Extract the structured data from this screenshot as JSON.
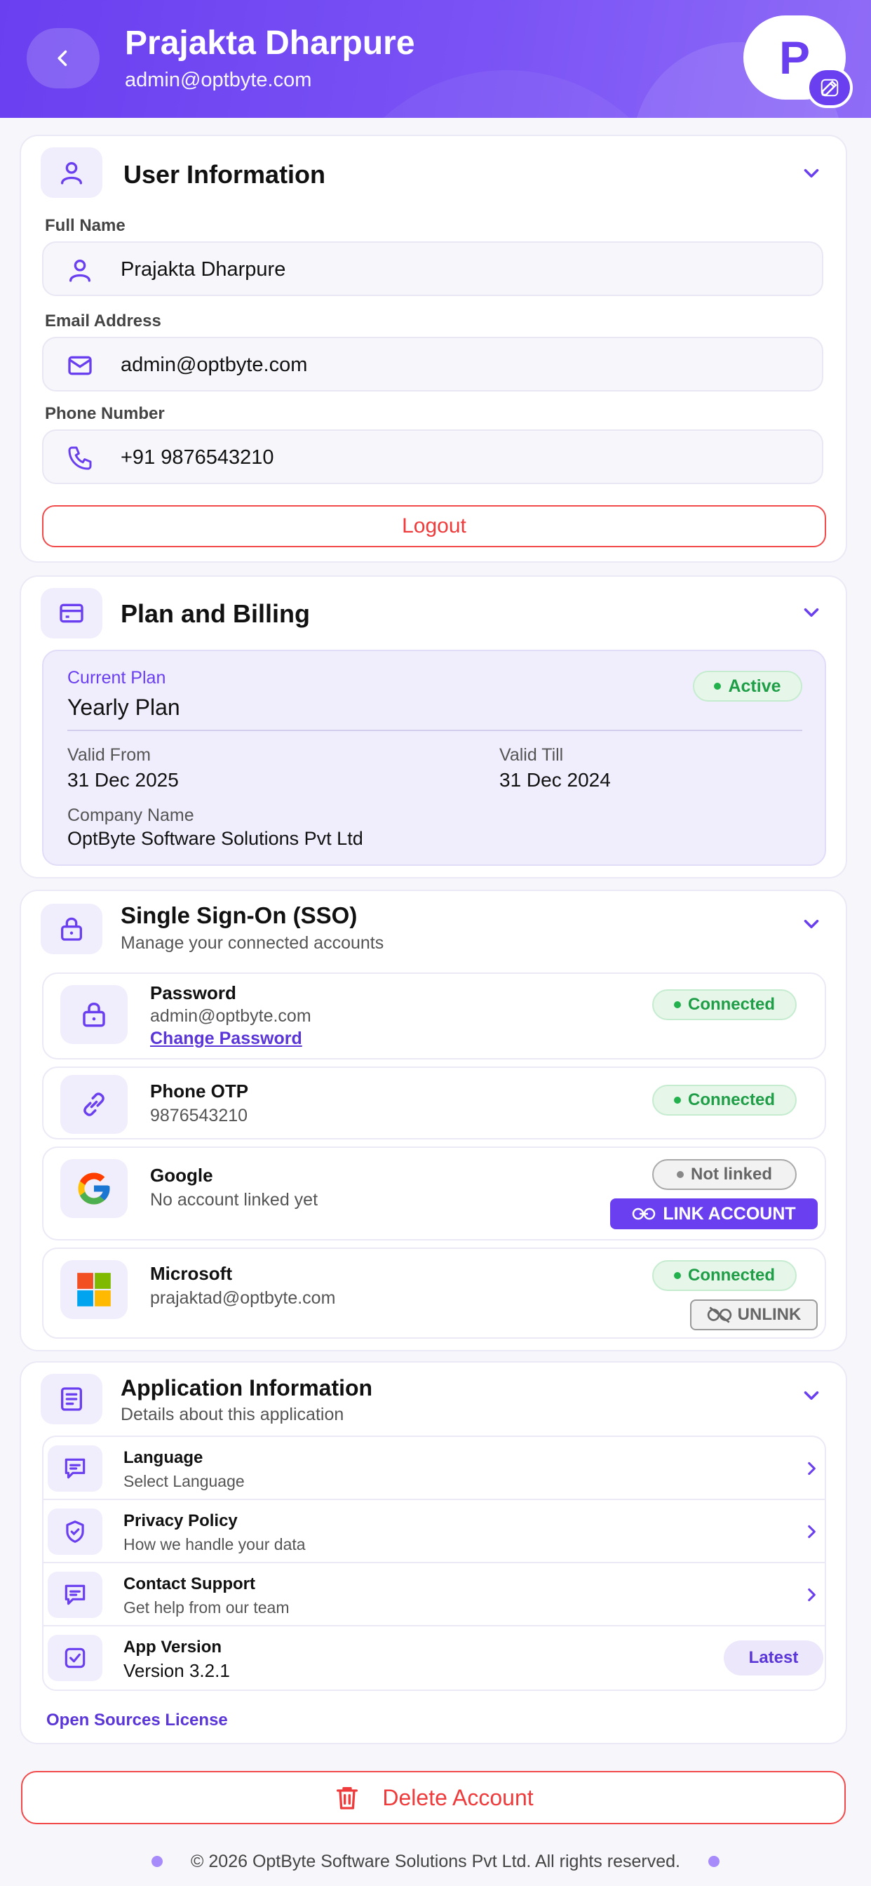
{
  "header": {
    "name": "Prajakta Dharpure",
    "email": "admin@optbyte.com",
    "avatar_initial": "P",
    "accent": "#6a3ff0"
  },
  "user_info": {
    "title": "User Information",
    "fields": [
      {
        "label": "Full Name",
        "value": "Prajakta Dharpure",
        "icon": "user-icon"
      },
      {
        "label": "Email Address",
        "value": "admin@optbyte.com",
        "icon": "mail-icon"
      },
      {
        "label": "Phone Number",
        "value": "+91 9876543210",
        "icon": "phone-icon"
      }
    ],
    "logout_label": "Logout"
  },
  "plan": {
    "title": "Plan and Billing",
    "current_plan_label": "Current Plan",
    "plan_name": "Yearly Plan",
    "status": "Active",
    "valid_from_label": "Valid From",
    "valid_from": "31 Dec 2025",
    "valid_till_label": "Valid Till",
    "valid_till": "31 Dec 2024",
    "company_label": "Company Name",
    "company": "OptByte Software Solutions Pvt Ltd"
  },
  "sso": {
    "title": "Single Sign-On (SSO)",
    "subtitle": "Manage your connected accounts",
    "items": [
      {
        "name": "Password",
        "detail": "admin@optbyte.com",
        "action": "Change Password",
        "status": "Connected",
        "icon": "lock-icon"
      },
      {
        "name": "Phone OTP",
        "detail": "9876543210",
        "status": "Connected",
        "icon": "link-icon"
      },
      {
        "name": "Google",
        "detail": "No account linked yet",
        "status": "Not linked",
        "action": "LINK ACCOUNT",
        "icon": "google-icon"
      },
      {
        "name": "Microsoft",
        "detail": "prajaktad@optbyte.com",
        "status": "Connected",
        "action": "UNLINK",
        "icon": "microsoft-icon"
      }
    ]
  },
  "app_info": {
    "title": "Application Information",
    "subtitle": "Details about this application",
    "rows": [
      {
        "title": "Language",
        "subtitle": "Select Language",
        "icon": "chat-icon"
      },
      {
        "title": "Privacy Policy",
        "subtitle": "How we handle your data",
        "icon": "shield-icon"
      },
      {
        "title": "Contact Support",
        "subtitle": "Get help from our team",
        "icon": "support-icon"
      },
      {
        "title": "App Version",
        "subtitle": "Version 3.2.1",
        "badge": "Latest",
        "icon": "check-icon"
      }
    ],
    "oss_link": "Open Sources License"
  },
  "delete_label": "Delete Account",
  "footer": "© 2026 OptByte Software Solutions Pvt Ltd. All rights reserved.",
  "colors": {
    "accent": "#6a3ff0",
    "danger": "#ef3b3b",
    "success": "#1f9e47"
  }
}
